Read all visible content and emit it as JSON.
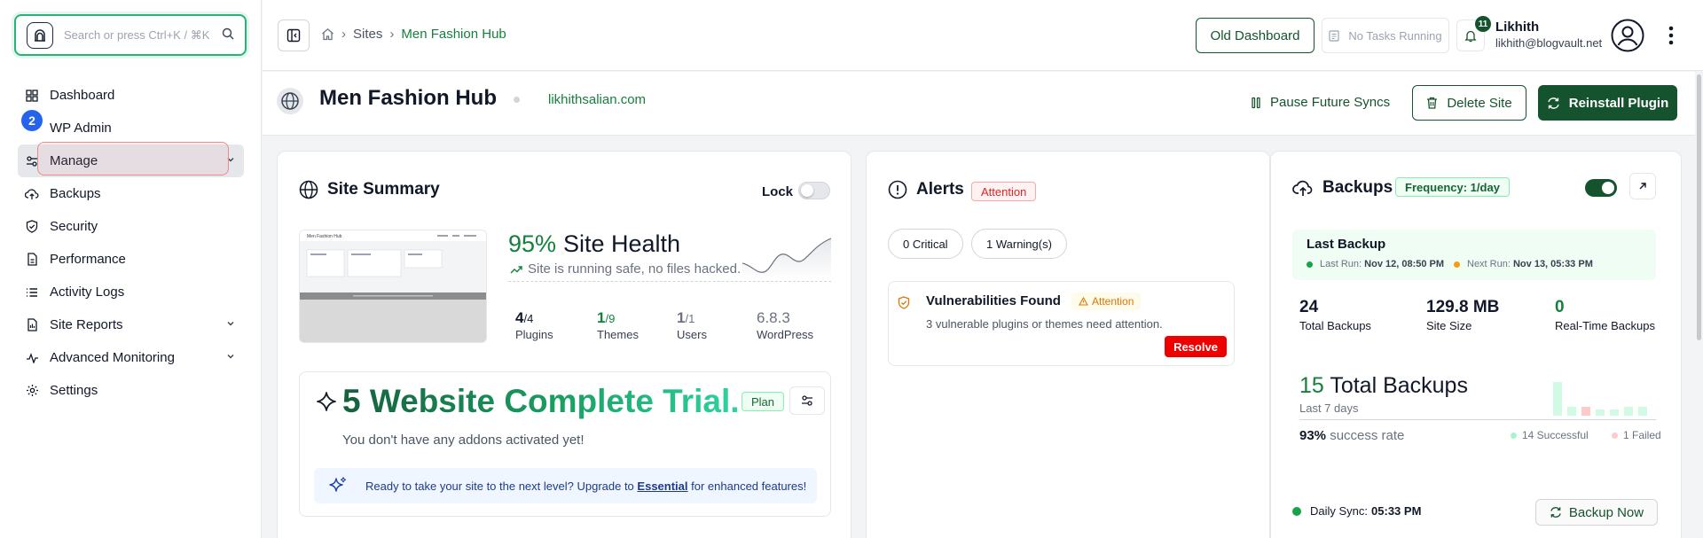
{
  "sidebar": {
    "search_placeholder": "Search or press Ctrl+K / ⌘K",
    "step_badge": "2",
    "items": [
      {
        "label": "Dashboard",
        "icon": "dashboard-grid-icon"
      },
      {
        "label": "WP Admin",
        "icon": "wordpress-icon"
      },
      {
        "label": "Manage",
        "icon": "sliders-icon",
        "chevron": true,
        "active": true
      },
      {
        "label": "Backups",
        "icon": "cloud-upload-icon"
      },
      {
        "label": "Security",
        "icon": "shield-check-icon"
      },
      {
        "label": "Performance",
        "icon": "document-icon"
      },
      {
        "label": "Activity Logs",
        "icon": "list-icon"
      },
      {
        "label": "Site Reports",
        "icon": "report-icon",
        "chevron": true
      },
      {
        "label": "Advanced Monitoring",
        "icon": "activity-icon",
        "chevron": true
      },
      {
        "label": "Settings",
        "icon": "gear-icon"
      }
    ]
  },
  "topbar": {
    "breadcrumbs": [
      "Sites",
      "Men Fashion Hub"
    ],
    "old_dashboard": "Old Dashboard",
    "tasks": "No Tasks Running",
    "notification_count": "11",
    "user_name": "Likhith",
    "user_email": "likhith@blogvault.net"
  },
  "site": {
    "name": "Men Fashion Hub",
    "url": "likhithsalian.com",
    "pause": "Pause Future Syncs",
    "delete": "Delete Site",
    "reinstall": "Reinstall Plugin"
  },
  "summary": {
    "title": "Site Summary",
    "lock": "Lock",
    "lock_on": false,
    "thumbnail_title": "Men Fashion Hub",
    "health_pct": "95%",
    "health_label": "Site Health",
    "health_sub": "Site is running safe, no files hacked.",
    "stats": [
      {
        "value": "4",
        "total": "/4",
        "label": "Plugins"
      },
      {
        "value": "1",
        "total": "/9",
        "label": "Themes"
      },
      {
        "value": "1",
        "total": "/1",
        "label": "Users"
      },
      {
        "value": "6.8.3",
        "total": "",
        "label": "WordPress"
      }
    ],
    "trial_title": "5 Website Complete Trial.",
    "plan": "Plan",
    "no_addons": "You don't have any addons activated yet!",
    "upgrade_pre": "Ready to take your site to the next level? Upgrade to",
    "upgrade_link": "Essential",
    "upgrade_post": "for enhanced features!"
  },
  "alerts": {
    "title": "Alerts",
    "badge": "Attention",
    "critical": "0 Critical",
    "warnings": "1 Warning(s)",
    "vuln_title": "Vulnerabilities Found",
    "vuln_tag": "Attention",
    "vuln_desc": "3 vulnerable plugins or themes need attention.",
    "resolve": "Resolve"
  },
  "backups": {
    "title": "Backups",
    "frequency": "Frequency: 1/day",
    "enabled": true,
    "last_backup": "Last Backup",
    "last_run_label": "Last Run:",
    "last_run": "Nov 12, 08:50 PM",
    "next_run_label": "Next Run:",
    "next_run": "Nov 13, 05:33 PM",
    "total_backups": "24",
    "total_backups_label": "Total Backups",
    "site_size": "129.8 MB",
    "site_size_label": "Site Size",
    "realtime": "0",
    "realtime_label": "Real-Time Backups",
    "week_count": "15",
    "week_label": "Total Backups",
    "week_sub": "Last 7 days",
    "success_rate": "93%",
    "success_label": "success rate",
    "successful": "14 Successful",
    "failed": "1 Failed",
    "daily_sync_label": "Daily Sync:",
    "daily_sync": "05:33 PM",
    "backup_now": "Backup Now"
  },
  "colors": {
    "brand": "#14532d",
    "accent_green": "#15803d",
    "danger": "#ef0000"
  }
}
